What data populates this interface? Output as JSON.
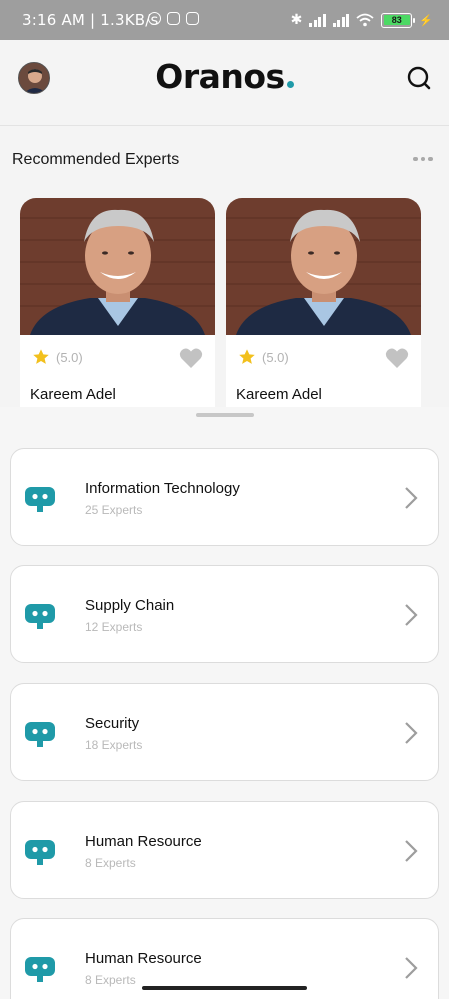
{
  "status_bar": {
    "time_speed": "3:16 AM | 1.3KB/s",
    "battery": "83"
  },
  "header": {
    "brand": "Oranos",
    "accent_color": "#1f9aa8"
  },
  "recommended": {
    "title": "Recommended Experts",
    "experts": [
      {
        "name": "Kareem Adel",
        "rating": "(5.0)"
      },
      {
        "name": "Kareem Adel",
        "rating": "(5.0)"
      }
    ]
  },
  "categories": [
    {
      "name": "Information Technology",
      "count": "25 Experts",
      "icon": "robot-icon"
    },
    {
      "name": "Supply Chain",
      "count": "12 Experts",
      "icon": "robot-icon"
    },
    {
      "name": "Security",
      "count": "18 Experts",
      "icon": "robot-icon"
    },
    {
      "name": "Human Resource",
      "count": "8 Experts",
      "icon": "robot-icon"
    },
    {
      "name": "Human Resource",
      "count": "8 Experts",
      "icon": "robot-icon"
    }
  ]
}
